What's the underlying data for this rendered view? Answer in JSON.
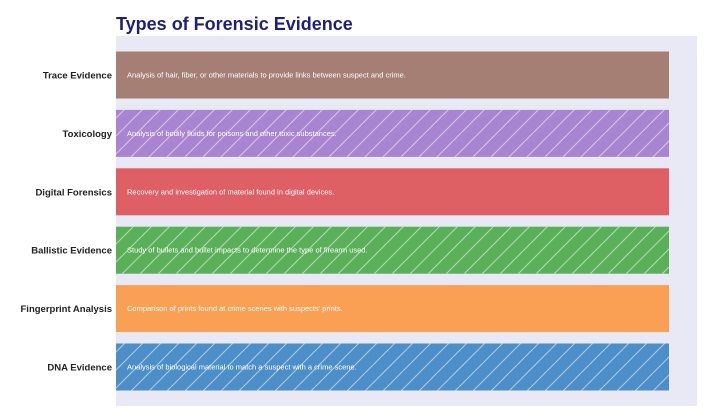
{
  "chart_data": {
    "type": "bar",
    "orientation": "horizontal",
    "title": "Types of Forensic Evidence",
    "xlabel": "",
    "ylabel": "",
    "grid": false,
    "categories": [
      "Trace Evidence",
      "Toxicology",
      "Digital Forensics",
      "Ballistic Evidence",
      "Fingerprint Analysis",
      "DNA Evidence"
    ],
    "values": [
      1,
      1,
      1,
      1,
      1,
      1
    ],
    "descriptions": [
      "Analysis of hair, fiber, or other materials to provide links between suspect and crime.",
      "Analysis of bodily fluids for poisons and other toxic substances.",
      "Recovery and investigation of material found in digital devices.",
      "Study of bullets and bullet impacts to determine the type of firearm used.",
      "Comparison of prints found at crime scenes with suspects' prints.",
      "Analysis of biological material to match a suspect with a crime scene."
    ],
    "colors": [
      "#a57e74",
      "#a984d0",
      "#de5f64",
      "#59b058",
      "#f9a055",
      "#4c8ec7"
    ],
    "hatched": [
      false,
      true,
      false,
      true,
      false,
      true
    ],
    "plot_background": "#e8e9f4"
  }
}
